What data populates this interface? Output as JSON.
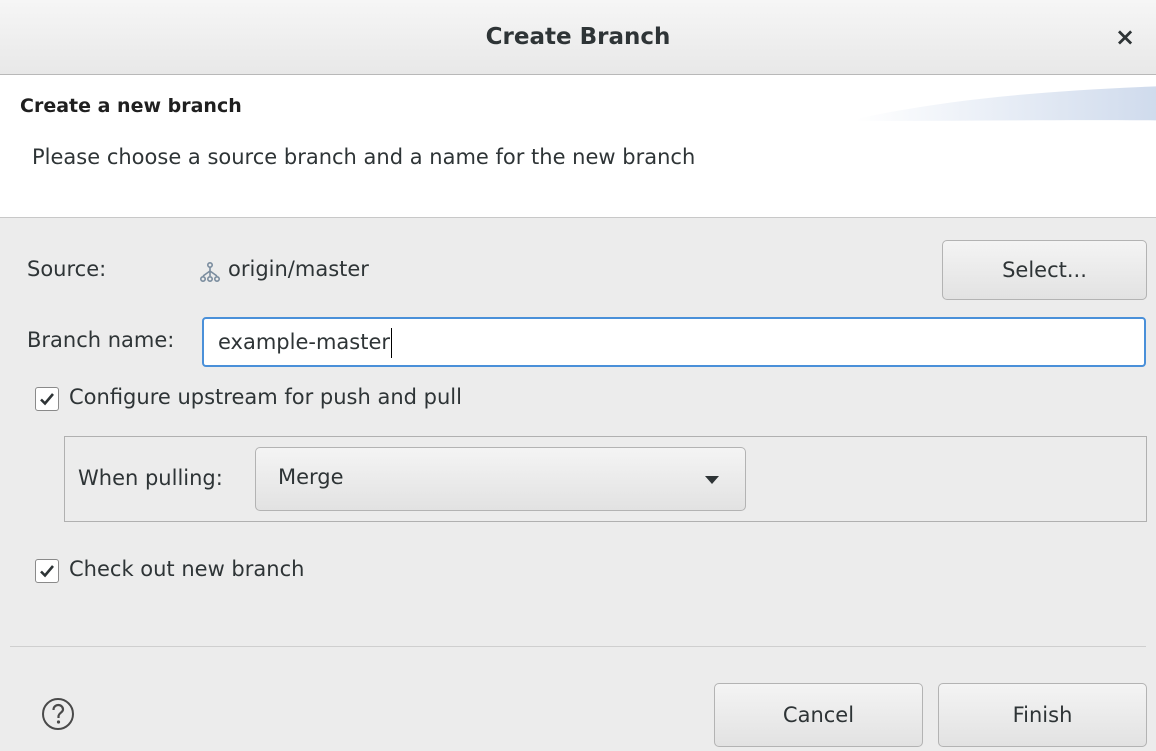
{
  "window": {
    "title": "Create Branch",
    "close_glyph": "×"
  },
  "banner": {
    "heading": "Create a new branch",
    "description": "Please choose a source branch and a name for the new branch"
  },
  "form": {
    "source_label": "Source:",
    "source_value": "origin/master",
    "select_label": "Select...",
    "branch_name_label": "Branch name:",
    "branch_name_value": "example-master",
    "configure_upstream": {
      "label": "Configure upstream for push and pull",
      "checked": true
    },
    "when_pulling_label": "When pulling:",
    "when_pulling_value": "Merge",
    "checkout": {
      "label": "Check out new branch",
      "checked": true
    }
  },
  "footer": {
    "cancel_label": "Cancel",
    "finish_label": "Finish"
  },
  "icons": {
    "close": "close-icon",
    "source": "remote-branch-icon",
    "checkbox": "checkmark-icon",
    "dropdown": "chevron-down-icon",
    "help": "help-icon"
  },
  "colors": {
    "focus": "#4a90d9",
    "background": "#ececec"
  }
}
